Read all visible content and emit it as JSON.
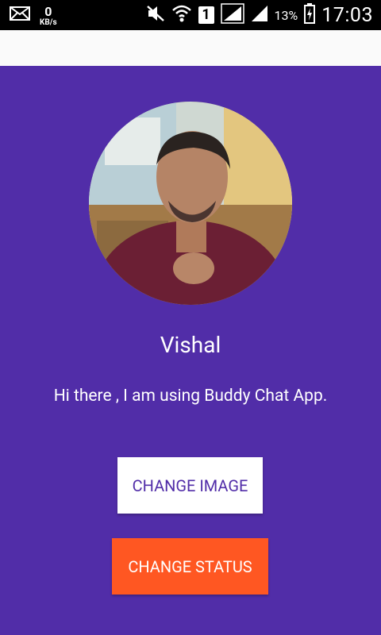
{
  "status_bar": {
    "net_speed_value": "0",
    "net_speed_unit": "KB/s",
    "sim_slot": "1",
    "battery_percent": "13%",
    "time": "17:03",
    "icons": [
      "mail-icon",
      "mute-icon",
      "wifi-icon",
      "signal-icon",
      "battery-charging-icon"
    ]
  },
  "profile": {
    "name": "Vishal",
    "status": "Hi there , I am using Buddy Chat App."
  },
  "buttons": {
    "change_image": "CHANGE IMAGE",
    "change_status": "CHANGE STATUS"
  },
  "colors": {
    "primary": "#512da8",
    "accent": "#ff5722",
    "toolbar": "#fafafa",
    "statusbar": "#000000"
  }
}
